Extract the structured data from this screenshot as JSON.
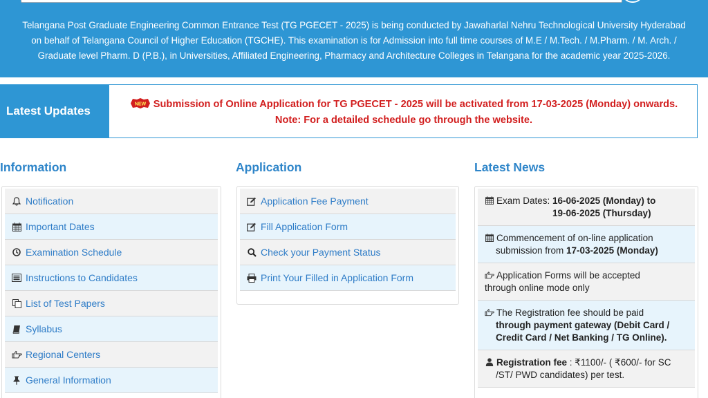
{
  "banner": {
    "line1": "Telangana Post Graduate Engineering Common Entrance Test (TG PGECET - 2025) is being conducted by Jawaharlal Nehru Technological University Hyderabad",
    "line2": "on behalf of Telangana Council of Higher Education (TGCHE). This examination is for Admission into full time courses of M.E / M.Tech. / M.Pharm. / M. Arch. /",
    "line3": "Graduate level Pharm. D (P.B.), in Universities, Affiliated Engineering, Pharmacy and Architecture Colleges in Telangana for the academic year 2025-2026."
  },
  "updates": {
    "label": "Latest Updates",
    "badge": "NEW",
    "line1": "Submission of Online Application for TG PGECET - 2025 will be activated from 17-03-2025 (Monday) onwards.",
    "line2": "Note: For a detailed schedule go through the website."
  },
  "information": {
    "heading": "Information",
    "items": [
      {
        "label": "Notification",
        "icon": "bell-icon"
      },
      {
        "label": "Important Dates",
        "icon": "calendar-icon"
      },
      {
        "label": "Examination Schedule",
        "icon": "clock-icon"
      },
      {
        "label": "Instructions to Candidates",
        "icon": "list-alt-icon"
      },
      {
        "label": "List of Test Papers",
        "icon": "copy-icon"
      },
      {
        "label": "Syllabus",
        "icon": "book-icon"
      },
      {
        "label": "Regional Centers",
        "icon": "hand-pointer-icon"
      },
      {
        "label": "General Information",
        "icon": "pin-icon"
      }
    ]
  },
  "application": {
    "heading": "Application",
    "items": [
      {
        "label": "Application Fee Payment",
        "icon": "edit-icon"
      },
      {
        "label": "Fill Application Form",
        "icon": "edit-icon"
      },
      {
        "label": "Check your Payment Status",
        "icon": "search-icon"
      },
      {
        "label": "Print Your Filled in Application Form",
        "icon": "print-icon"
      }
    ]
  },
  "news": {
    "heading": "Latest News",
    "exam_prefix": "Exam Dates: ",
    "exam_dates_a": "16-06-2025 (Monday) to",
    "exam_dates_b": "19-06-2025 (Thursday)",
    "commence_a": "Commencement of on-line application",
    "commence_b": "submission from ",
    "commence_date": "17-03-2025 (Monday)",
    "forms_a": "Application Forms will be accepted",
    "forms_b": "through online mode only",
    "fee_a": "The Registration fee should be paid",
    "fee_b": "through payment gateway (Debit Card /",
    "fee_c": "Credit Card / Net Banking / TG Online).",
    "reg_label": "Registration fee",
    "reg_text_a": " : ₹1100/- ( ₹600/- for SC",
    "reg_text_b": "/ST/ PWD candidates) per test."
  },
  "colors": {
    "brand_blue": "#2e96d4",
    "link_blue": "#2e7cc7",
    "alert_red": "#d21f1f"
  }
}
